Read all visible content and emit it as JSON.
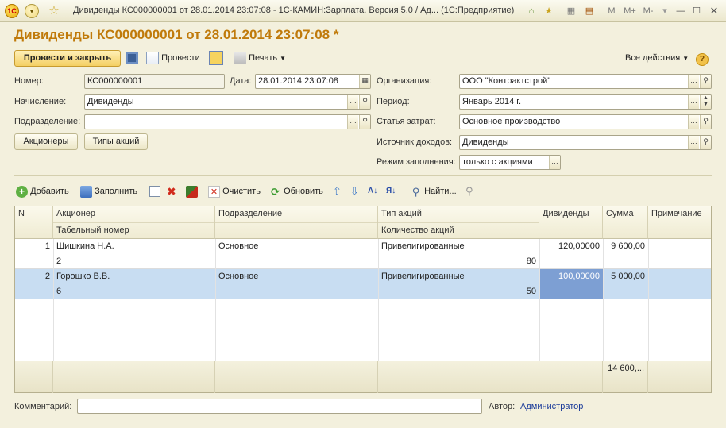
{
  "window": {
    "title": "Дивиденды КС000000001 от 28.01.2014 23:07:08 - 1С-КАМИН:Зарплата. Версия 5.0 / Ад...   (1С:Предприятие)",
    "logo_text": "1С",
    "memory_buttons": [
      "M",
      "M+",
      "M-"
    ]
  },
  "doc_title": "Дивиденды КС000000001 от 28.01.2014 23:07:08 *",
  "toolbar": {
    "post_close": "Провести и закрыть",
    "post": "Провести",
    "print": "Печать",
    "all_actions": "Все действия"
  },
  "form": {
    "number_label": "Номер:",
    "number_value": "КС000000001",
    "date_label": "Дата:",
    "date_value": "28.01.2014 23:07:08",
    "accrual_label": "Начисление:",
    "accrual_value": "Дивиденды",
    "department_label": "Подразделение:",
    "department_value": "",
    "org_label": "Организация:",
    "org_value": "ООО \"Контрактстрой\"",
    "period_label": "Период:",
    "period_value": "Январь 2014 г.",
    "cost_label": "Статья затрат:",
    "cost_value": "Основное производство",
    "income_label": "Источник доходов:",
    "income_value": "Дивиденды",
    "fill_mode_label": "Режим заполнения:",
    "fill_mode_value": "только с акциями",
    "shareholders_button": "Акционеры",
    "share_types_button": "Типы акций"
  },
  "table_toolbar": {
    "add": "Добавить",
    "fill": "Заполнить",
    "clear": "Очистить",
    "refresh": "Обновить",
    "find": "Найти..."
  },
  "table": {
    "headers": {
      "n": "N",
      "shareholder": "Акционер",
      "tab_number": "Табельный номер",
      "department": "Подразделение",
      "share_type": "Тип акций",
      "share_count": "Количество акций",
      "dividends": "Дивиденды",
      "sum": "Сумма",
      "note": "Примечание"
    },
    "rows": [
      {
        "n": "1",
        "shareholder": "Шишкина Н.А.",
        "tab_number": "2",
        "department": "Основное",
        "share_type": "Привелигированные",
        "share_count": "80",
        "dividends": "120,00000",
        "sum": "9 600,00",
        "note": ""
      },
      {
        "n": "2",
        "shareholder": "Горошко В.В.",
        "tab_number": "6",
        "department": "Основное",
        "share_type": "Привелигированные",
        "share_count": "50",
        "dividends": "100,00000",
        "sum": "5 000,00",
        "note": ""
      }
    ],
    "total_sum": "14 600,..."
  },
  "footer": {
    "comment_label": "Комментарий:",
    "comment_value": "",
    "author_label": "Автор:",
    "author_value": "Администратор"
  }
}
